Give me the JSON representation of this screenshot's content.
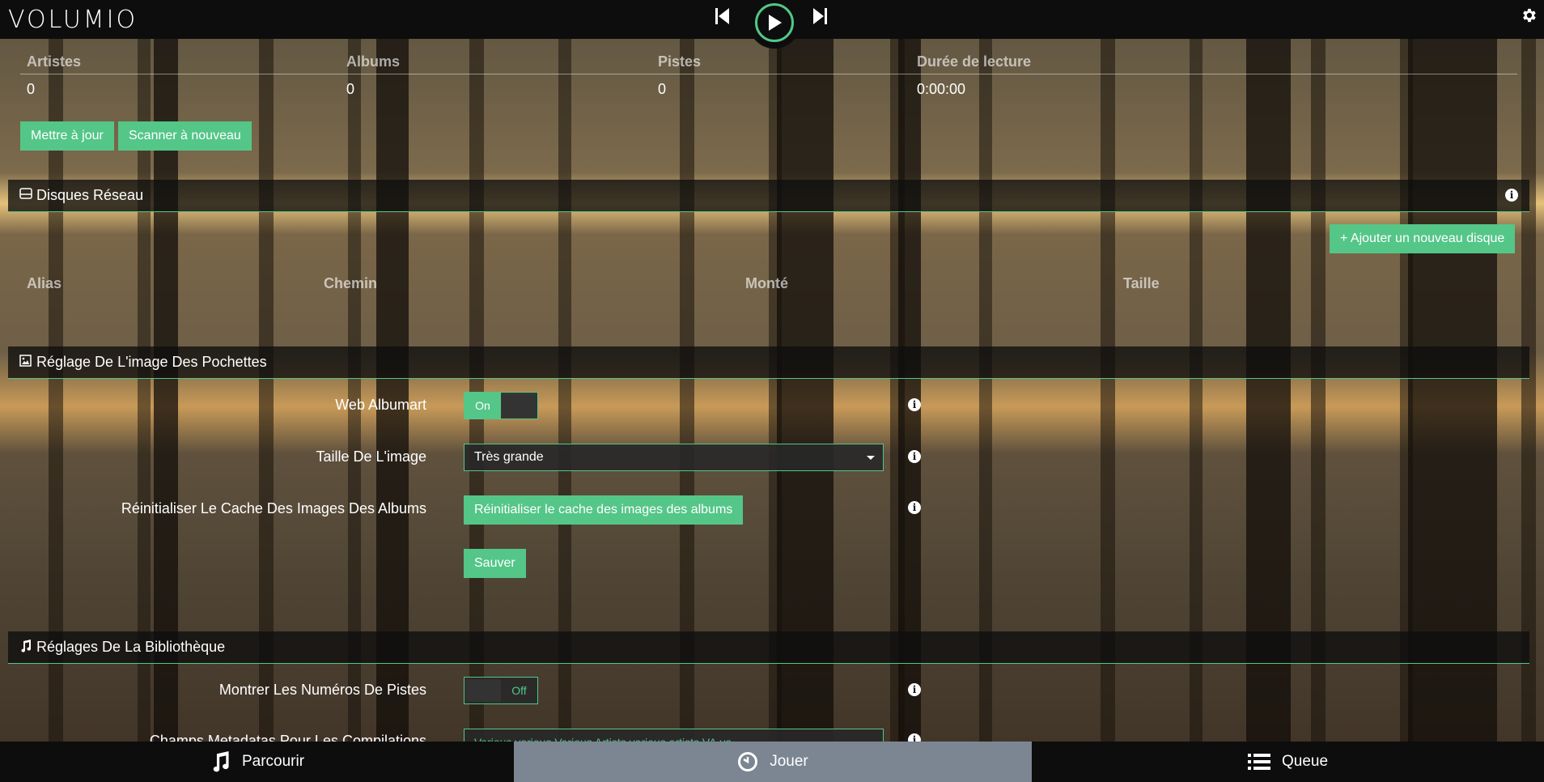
{
  "app": {
    "logo": "VOLUMIO"
  },
  "library": {
    "headers": [
      "Artistes",
      "Albums",
      "Pistes",
      "Durée de lecture"
    ],
    "values": [
      "0",
      "0",
      "0",
      "0:00:00"
    ],
    "update_label": "Mettre à jour",
    "rescan_label": "Scanner à nouveau"
  },
  "network_drives": {
    "title": "Disques Réseau",
    "add_label": "Ajouter un nouveau disque",
    "columns": [
      "Alias",
      "Chemin",
      "Monté",
      "Taille"
    ]
  },
  "albumart": {
    "title": "Réglage De L'image Des Pochettes",
    "web_albumart_label": "Web Albumart",
    "web_albumart_state": "On",
    "image_size_label": "Taille De L'image",
    "image_size_value": "Très grande",
    "reset_cache_label": "Réinitialiser Le Cache Des Images Des Albums",
    "reset_cache_button": "Réinitialiser le cache des images des albums",
    "save_label": "Sauver"
  },
  "library_settings": {
    "title": "Réglages De La Bibliothèque",
    "track_numbers_label": "Montrer Les Numéros De Pistes",
    "track_numbers_state": "Off",
    "compilation_label": "Champs Metadatas Pour Les Compilations",
    "compilation_value": "Various,various,Various Artists,various artists,VA,va"
  },
  "nav": {
    "browse": "Parcourir",
    "play": "Jouer",
    "queue": "Queue"
  },
  "colors": {
    "accent": "#54c688",
    "bar": "#0d0d0d",
    "active_tab": "#7b8692"
  }
}
